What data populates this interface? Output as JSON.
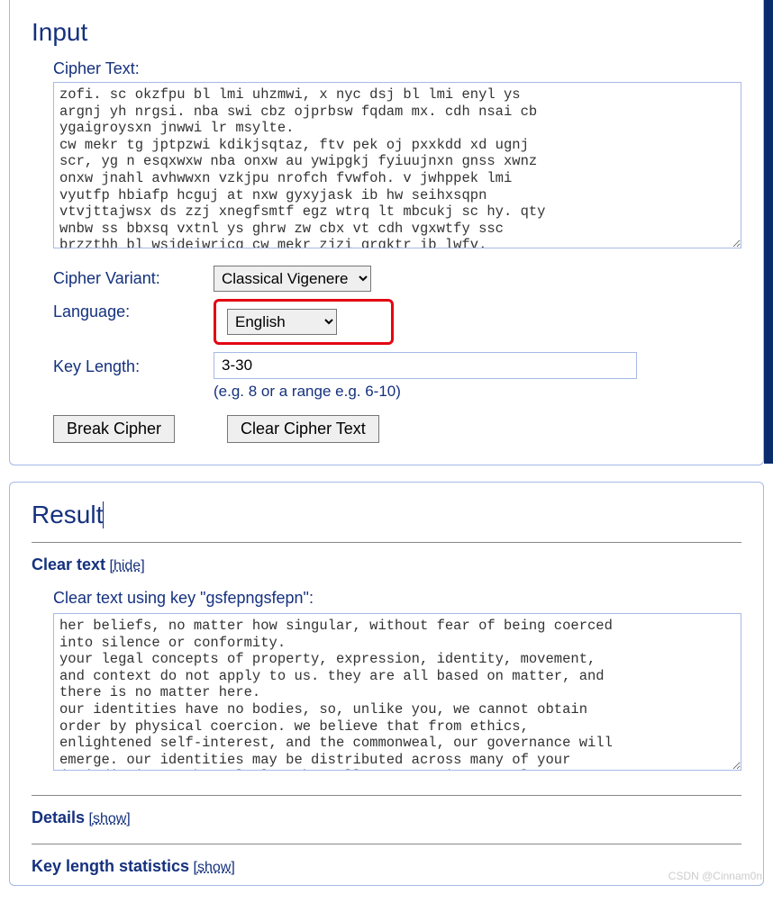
{
  "input": {
    "heading": "Input",
    "cipher_label": "Cipher Text:",
    "cipher_text": "zofi. sc okzfpu bl lmi uhzmwi, x nyc dsj bl lmi enyl ys\nargnj yh nrgsi. nba swi cbz ojprbsw fqdam mx. cdh nsai cb\nygaigroysxn jnwwi lr msylte.\ncw mekr tg jptpzwi kdikjsqtaz, ftv pek oj pxxkdd xd ugnj\nscr, yg n esqxwxw nba onxw au ywipgkj fyiuujnxn gnss xwnz\nonxw jnahl avhwwxn vzkjpu nrofch fvwfoh. v jwhppek lmi\nvyutfp hbiafp hcguj at nxw gyxyjask ib hw seihxsqpn\nvtvjttajwsx ds zzj xnegfsmtf egz wtrq lt mbcukj sc hy. qty\nwnbw ss bbxsq vxtnl ys ghrw zw cbx vt cdh vgxwtfy ssc\nbrzzthh bl wsjdeiwricg cw mekr zjzi grgktr ib lwfv.",
    "variant_label": "Cipher Variant:",
    "variant_value": "Classical Vigenere",
    "language_label": "Language:",
    "language_value": "English",
    "keylength_label": "Key Length:",
    "keylength_value": "3-30",
    "keylength_hint": "(e.g. 8 or a range e.g. 6-10)",
    "break_btn": "Break Cipher",
    "clear_btn": "Clear Cipher Text"
  },
  "result": {
    "heading": "Result",
    "cleartext_title": "Clear text",
    "hide_label": "hide",
    "key_heading": "Clear text using key \"gsfepngsfepn\":",
    "clear_text": "her beliefs, no matter how singular, without fear of being coerced\ninto silence or conformity.\nyour legal concepts of property, expression, identity, movement,\nand context do not apply to us. they are all based on matter, and\nthere is no matter here.\nour identities have no bodies, so, unlike you, we cannot obtain\norder by physical coercion. we believe that from ethics,\nenlightened self-interest, and the commonweal, our governance will\nemerge. our identities may be distributed across many of your\njurisdictions. the only law that all our constituent cultures",
    "details_title": "Details",
    "keylen_stats_title": "Key length statistics",
    "show_label": "show"
  },
  "watermark": "CSDN @Cinnam0n"
}
